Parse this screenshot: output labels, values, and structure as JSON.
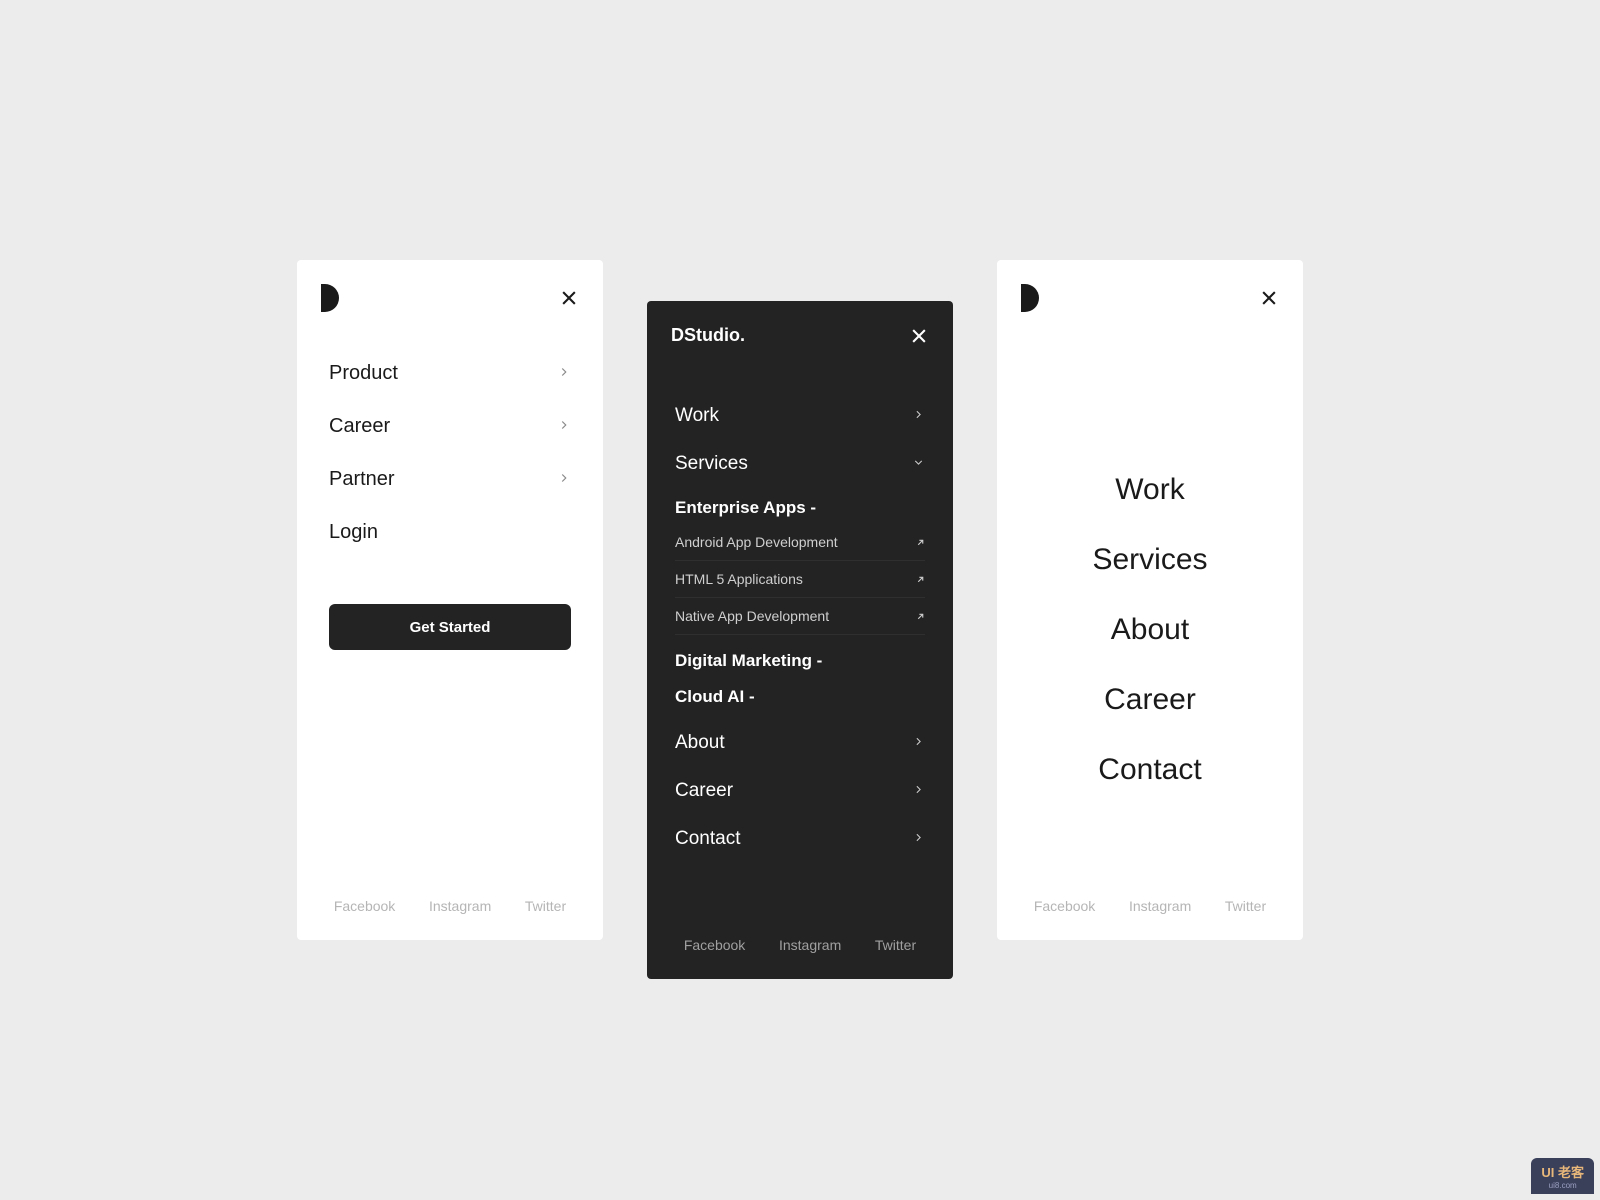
{
  "screen1": {
    "nav": [
      {
        "label": "Product",
        "chevron": true
      },
      {
        "label": "Career",
        "chevron": true
      },
      {
        "label": "Partner",
        "chevron": true
      },
      {
        "label": "Login",
        "chevron": false
      }
    ],
    "cta": "Get Started",
    "footer": [
      "Facebook",
      "Instagram",
      "Twitter"
    ]
  },
  "screen2": {
    "brand": "DStudio.",
    "top": [
      {
        "label": "Work",
        "icon": "chevron-right"
      },
      {
        "label": "Services",
        "icon": "chevron-down"
      }
    ],
    "section1_head": "Enterprise Apps -",
    "section1_items": [
      "Android App Development",
      "HTML 5 Applications",
      "Native App Development"
    ],
    "section2_head": "Digital Marketing -",
    "section3_head": "Cloud AI -",
    "bottom": [
      {
        "label": "About"
      },
      {
        "label": "Career"
      },
      {
        "label": "Contact"
      }
    ],
    "footer": [
      "Facebook",
      "Instagram",
      "Twitter"
    ]
  },
  "screen3": {
    "nav": [
      "Work",
      "Services",
      "About",
      "Career",
      "Contact"
    ],
    "footer": [
      "Facebook",
      "Instagram",
      "Twitter"
    ]
  },
  "watermark": {
    "main": "UI 老客",
    "sub": "ui8.com"
  }
}
